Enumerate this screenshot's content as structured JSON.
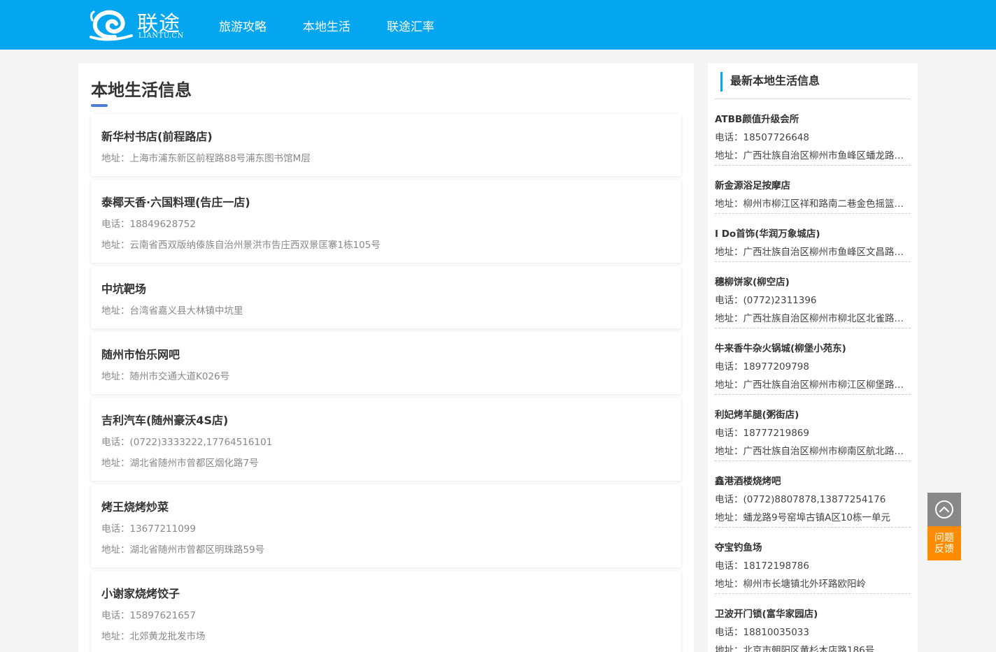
{
  "header": {
    "logo_text": "联途",
    "logo_sub": "LIANTU.CN",
    "nav": [
      "旅游攻略",
      "本地生活",
      "联途汇率"
    ]
  },
  "main": {
    "title": "本地生活信息",
    "cards": [
      {
        "name": "新华村书店(前程路店)",
        "lines": [
          "地址：上海市浦东新区前程路88号浦东图书馆M层"
        ]
      },
      {
        "name": "泰椰天香·六国料理(告庄一店)",
        "lines": [
          "电话：18849628752",
          "地址：云南省西双版纳傣族自治州景洪市告庄西双景匡寨1栋105号"
        ]
      },
      {
        "name": "中坑靶场",
        "lines": [
          "地址：台湾省嘉义县大林镇中坑里"
        ]
      },
      {
        "name": "随州市怡乐网吧",
        "lines": [
          "地址：随州市交通大道K026号"
        ]
      },
      {
        "name": "吉利汽车(随州豪沃4S店)",
        "lines": [
          "电话：(0722)3333222,17764516101",
          "地址：湖北省随州市曾都区烟化路7号"
        ]
      },
      {
        "name": "烤王烧烤炒菜",
        "lines": [
          "电话：13677211099",
          "地址：湖北省随州市曾都区明珠路59号"
        ]
      },
      {
        "name": "小谢家烧烤饺子",
        "lines": [
          "电话：15897621657",
          "地址：北郊黄龙批发市场"
        ]
      }
    ]
  },
  "sidebar": {
    "title": "最新本地生活信息",
    "items": [
      {
        "name": "ATBB颜值升级会所",
        "lines": [
          "电话：18507726648",
          "地址：广西壮族自治区柳州市鱼峰区蟠龙路…"
        ]
      },
      {
        "name": "新金源浴足按摩店",
        "lines": [
          "地址：柳州市柳江区祥和路南二巷金色摇篮…"
        ]
      },
      {
        "name": "I Do首饰(华润万象城店)",
        "lines": [
          "地址：广西壮族自治区柳州市鱼峰区文昌路…"
        ]
      },
      {
        "name": "穗柳饼家(柳空店)",
        "lines": [
          "电话：(0772)2311396",
          "地址：广西壮族自治区柳州市柳北区北雀路…"
        ]
      },
      {
        "name": "牛来香牛杂火锅城(柳堡小苑东)",
        "lines": [
          "电话：18977209798",
          "地址：广西壮族自治区柳州市柳江区柳堡路…"
        ]
      },
      {
        "name": "利妃烤羊腿(粥街店)",
        "lines": [
          "电话：18777219869",
          "地址：广西壮族自治区柳州市柳南区航北路…"
        ]
      },
      {
        "name": "鑫港酒楼烧烤吧",
        "lines": [
          "电话：(0772)8807878,13877254176",
          "地址：蟠龙路9号窑埠古镇A区10栋一单元"
        ]
      },
      {
        "name": "夺宝钓鱼场",
        "lines": [
          "电话：18172198786",
          "地址：柳州市长塘镇北外环路欧阳岭"
        ]
      },
      {
        "name": "卫波开门锁(富华家园店)",
        "lines": [
          "电话：18810035033",
          "地址：北京市朝阳区黄杉木店路186号"
        ]
      }
    ]
  },
  "float": {
    "up_icon": "arrow-up-circle-icon",
    "feedback_line1": "问题",
    "feedback_line2": "反馈"
  }
}
